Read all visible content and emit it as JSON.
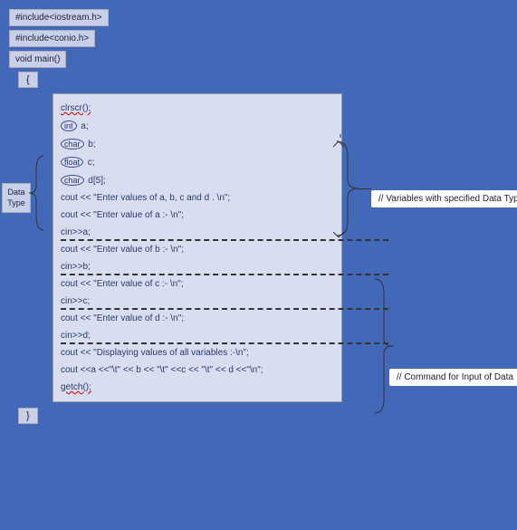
{
  "headers": {
    "h1": "#include<iostream.h>",
    "h2": "#include<conio.h>",
    "h3": "void main()"
  },
  "brackets": {
    "open": "{",
    "close": "}"
  },
  "code": {
    "l1": "clrscr();",
    "dt1": "int",
    "v1": " a;",
    "dt2": "char",
    "v2": " b;",
    "dt3": "float",
    "v3": " c;",
    "dt4": "char",
    "v4": " d[5];",
    "l6": "cout << \"Enter values of a, b, c and d . \\n\";",
    "l7": "cout << \"Enter value of  a :- \\n\";",
    "l8": "cin>>a;",
    "l9": "cout << \"Enter value of  b :- \\n\";",
    "l10": "cin>>b;",
    "l11": "cout << \"Enter value of  c :- \\n\";",
    "l12": "cin>>c;",
    "l13": "cout << \"Enter value of  d :- \\n\";",
    "l14": "cin>>d;",
    "l15": "cout << \"Displaying values of all variables :-\\n\";",
    "l16": "cout <<a <<\"\\t\" << b << \"\\t\" <<c << \"\\t\" << d <<\"\\n\";",
    "l17": "getch();"
  },
  "sidebar": {
    "label_line1": "Data",
    "label_line2": "Type"
  },
  "annotations": {
    "a1": "// Variables with specified Data Types",
    "a2": "// Command for Input of Data"
  }
}
